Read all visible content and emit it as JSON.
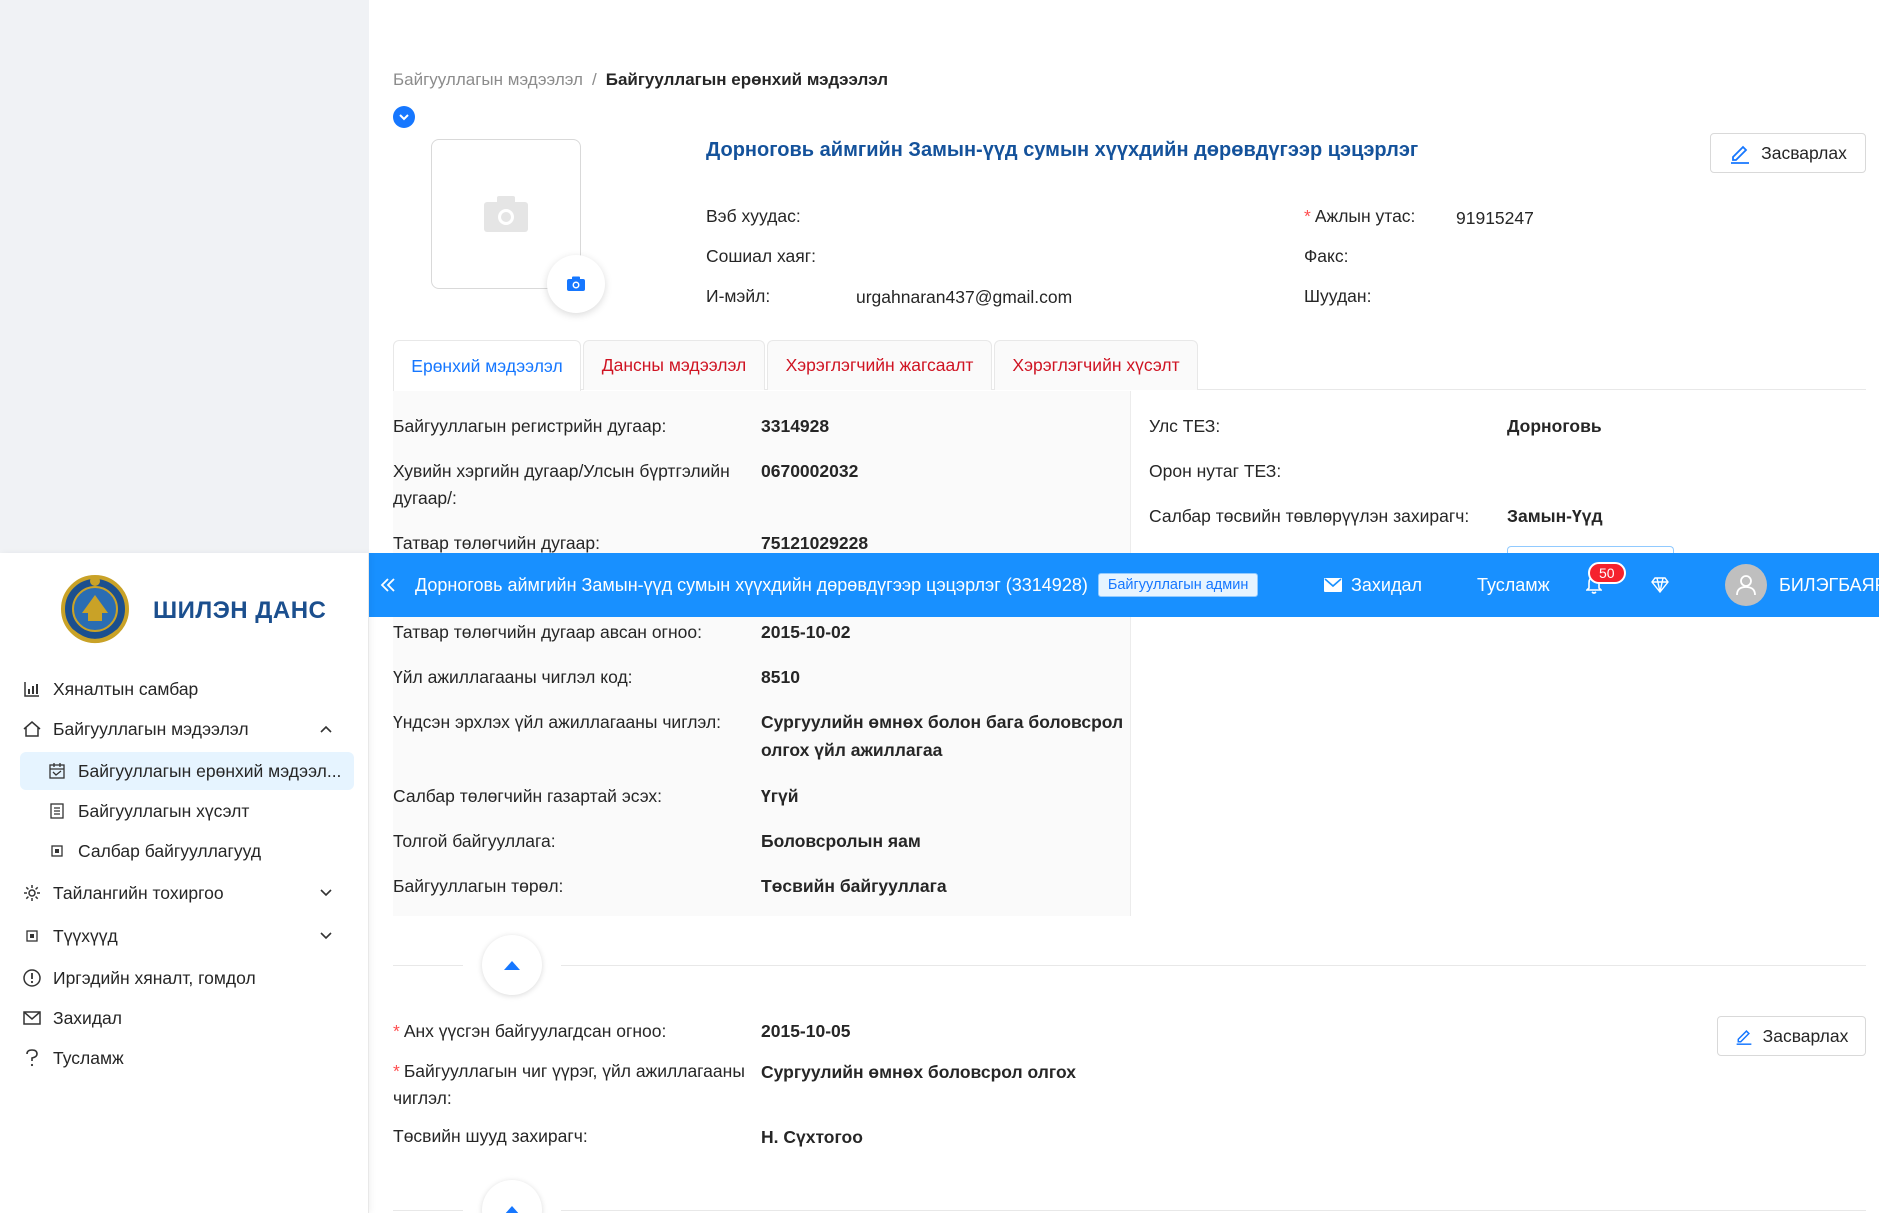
{
  "sidebar": {
    "logo_title": "ШИЛЭН ДАНС",
    "items": [
      {
        "label": "Хяналтын самбар",
        "icon": "bar-chart-icon"
      },
      {
        "label": "Байгууллагын мэдээлэл",
        "icon": "home-icon",
        "expanded": true
      },
      {
        "label": "Байгууллагын ерөнхий мэдээл...",
        "icon": "calendar-icon",
        "active": true
      },
      {
        "label": "Байгууллагын хүсэлт",
        "icon": "list-icon"
      },
      {
        "label": "Салбар байгууллагууд",
        "icon": "square-icon"
      },
      {
        "label": "Тайлангийн тохиргоо",
        "icon": "gear-icon"
      },
      {
        "label": "Түүхүүд",
        "icon": "square-icon"
      },
      {
        "label": "Иргэдийн хяналт, гомдол",
        "icon": "alert-icon"
      },
      {
        "label": "Захидал",
        "icon": "mail-icon"
      },
      {
        "label": "Тусламж",
        "icon": "question-icon"
      }
    ]
  },
  "topbar": {
    "org_name": "Дорноговь аймгийн Замын-үүд сумын хүүхдийн дөрөвдүгээр цэцэрлэг (3314928)",
    "role_tag": "Байгууллагын админ",
    "mail_label": "Захидал",
    "help_label": "Тусламж",
    "notification_count": "50",
    "user_name": "БИЛЭГБАЯР"
  },
  "breadcrumb": {
    "parent": "Байгууллагын мэдээлэл",
    "separator": "/",
    "current": "Байгууллагын ерөнхий мэдээлэл"
  },
  "profile": {
    "title": "Дорноговь аймгийн Замын-үүд сумын хүүхдийн дөрөвдүгээр цэцэрлэг",
    "edit_label": "Засварлах",
    "website_label": "Вэб хуудас:",
    "social_label": "Сошиал хаяг:",
    "email_label": "И-мэйл:",
    "email_value": "urgahnaran437@gmail.com",
    "phone_label": "Ажлын утас:",
    "phone_value": "91915247",
    "fax_label": "Факс:",
    "mail_label": "Шуудан:"
  },
  "tabs": [
    {
      "label": "Ерөнхий мэдээлэл",
      "active": true
    },
    {
      "label": "Дансны мэдээлэл"
    },
    {
      "label": "Хэрэглэгчийн жагсаалт"
    },
    {
      "label": "Хэрэглэгчийн хүсэлт"
    }
  ],
  "general": {
    "left": [
      {
        "label": "Байгууллагын регистрийн дугаар:",
        "value": "3314928"
      },
      {
        "label": "Хувийн хэргийн дугаар/Улсын бүртгэлийн",
        "label2": "дугаар/:",
        "value": "0670002032"
      },
      {
        "label": "Татвар төлөгчийн дугаар:",
        "value": "75121029228"
      },
      {
        "label": "Татвар төлөгчийн дугаар авсан огноо:",
        "value": "2015-10-02"
      },
      {
        "label": "Үйл ажиллагааны чиглэл код:",
        "value": "8510"
      },
      {
        "label": "Үндсэн эрхлэх үйл ажиллагааны чиглэл:",
        "value": "Сургуулийн өмнөх болон бага боловсрол",
        "value2": "олгох үйл ажиллагаа"
      },
      {
        "label": "Салбар төлөгчийн газартай эсэх:",
        "value": "Үгүй"
      },
      {
        "label": "Толгой байгууллага:",
        "value": "Боловсролын яам"
      },
      {
        "label": "Байгууллагын төрөл:",
        "value": "Төсвийн байгууллага"
      }
    ],
    "right": [
      {
        "label": "Улс ТЕЗ:",
        "value": "Дорноговь"
      },
      {
        "label": "Орон нутаг ТЕЗ:",
        "value": ""
      },
      {
        "label": "Салбар төсвийн төвлөрүүлэн захирагч:",
        "value": "Замын-Үүд"
      }
    ]
  },
  "extra": {
    "edit_label": "Засварлах",
    "founded_label": "Анх үүсгэн байгуулагдсан огноо:",
    "founded_value": "2015-10-05",
    "function_label": "Байгууллагын чиг үүрэг, үйл ажиллагааны",
    "function_label2": "чиглэл:",
    "function_value": "Сургуулийн өмнөх боловсрол олгох",
    "manager_label": "Төсвийн шууд захирагч:",
    "manager_value": "Н. Сүхтогоо"
  },
  "colors": {
    "primary": "#1890ff",
    "title_blue": "#14529b",
    "tab_red": "#cf1322",
    "badge_red": "#f5222d"
  }
}
